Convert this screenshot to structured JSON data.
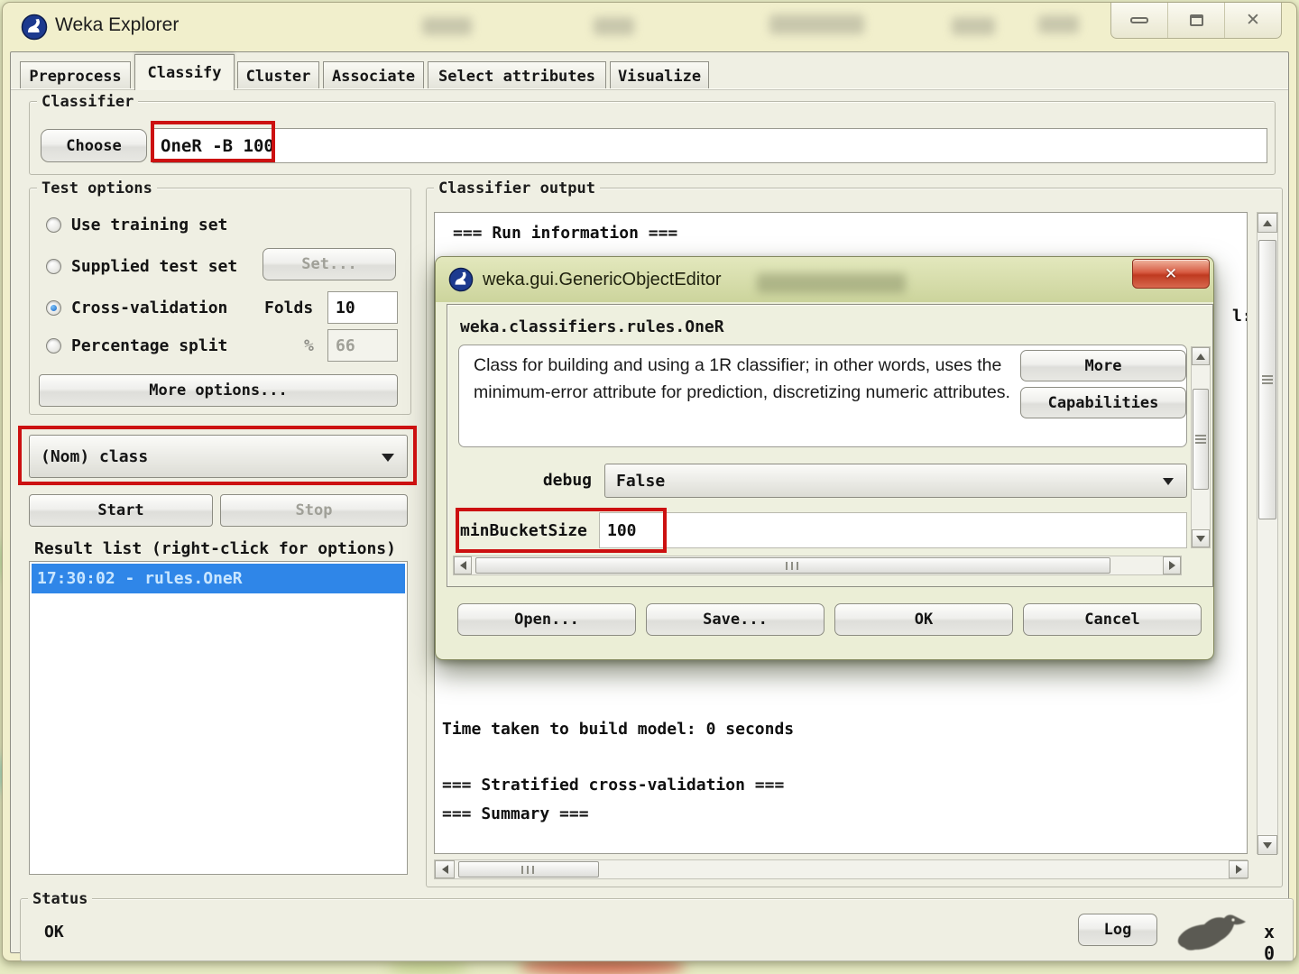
{
  "window": {
    "title": "Weka Explorer",
    "controls": {
      "minimize": "minimize",
      "maximize": "maximize",
      "close": "✕"
    }
  },
  "tabs": [
    {
      "label": "Preprocess"
    },
    {
      "label": "Classify"
    },
    {
      "label": "Cluster"
    },
    {
      "label": "Associate"
    },
    {
      "label": "Select attributes"
    },
    {
      "label": "Visualize"
    }
  ],
  "classifier_panel": {
    "group_label": "Classifier",
    "choose_button": "Choose",
    "classifier_spec": "OneR -B 100"
  },
  "test_options": {
    "group_label": "Test options",
    "use_training_set": "Use training set",
    "supplied_test_set": "Supplied test set",
    "set_button": "Set...",
    "cross_validation": "Cross-validation",
    "folds_label": "Folds",
    "folds_value": "10",
    "percentage_split": "Percentage split",
    "percent_label": "%",
    "percent_value": "66",
    "more_options_button": "More options..."
  },
  "class_selector": {
    "value": "(Nom) class"
  },
  "run_controls": {
    "start_button": "Start",
    "stop_button": "Stop"
  },
  "result_list": {
    "label": "Result list (right-click for options)",
    "items": [
      {
        "text": "17:30:02 - rules.OneR",
        "selected": true
      }
    ]
  },
  "output_panel": {
    "group_label": "Classifier output",
    "run_information": "=== Run information ===",
    "clipped_text": "l:",
    "time_taken": "Time taken to build model: 0 seconds",
    "stratified": "=== Stratified cross-validation ===",
    "summary": "=== Summary ==="
  },
  "dialog": {
    "title": "weka.gui.GenericObjectEditor",
    "close": "✕",
    "class_name": "weka.classifiers.rules.OneR",
    "description": "Class for building and using a 1R classifier; in other words, uses the minimum-error attribute for prediction, discretizing numeric attributes.",
    "more_button": "More",
    "capabilities_button": "Capabilities",
    "debug_label": "debug",
    "debug_value": "False",
    "min_bucket_size_label": "minBucketSize",
    "min_bucket_size_value": "100",
    "open_button": "Open...",
    "save_button": "Save...",
    "ok_button": "OK",
    "cancel_button": "Cancel"
  },
  "status_bar": {
    "group_label": "Status",
    "status_text": "OK",
    "log_button": "Log",
    "weka_counter": "x 0"
  },
  "colors": {
    "annotation_red": "#cc1111",
    "selection_blue": "#2f86e8",
    "dialog_titlebar_green": "#ccd49c",
    "close_button_red": "#d75b42"
  }
}
